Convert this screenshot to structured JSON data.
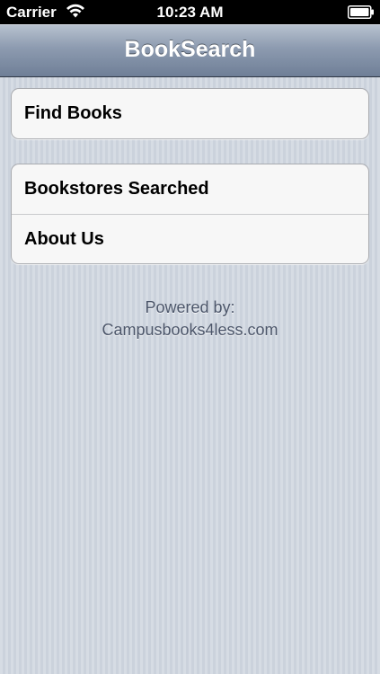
{
  "status_bar": {
    "carrier": "Carrier",
    "time": "10:23 AM",
    "icons": [
      "wifi-icon",
      "battery-icon"
    ]
  },
  "nav_bar": {
    "title": "BookSearch"
  },
  "menu": {
    "group1": [
      {
        "label": "Find Books"
      }
    ],
    "group2": [
      {
        "label": "Bookstores Searched"
      },
      {
        "label": "About Us"
      }
    ]
  },
  "footer": {
    "line1": "Powered by:",
    "line2": "Campusbooks4less.com"
  },
  "colors": {
    "nav_bar": "#8d9bb0",
    "background": "#cbd2dc",
    "cell_background": "#f7f7f7",
    "footer_text": "#4c566a"
  }
}
